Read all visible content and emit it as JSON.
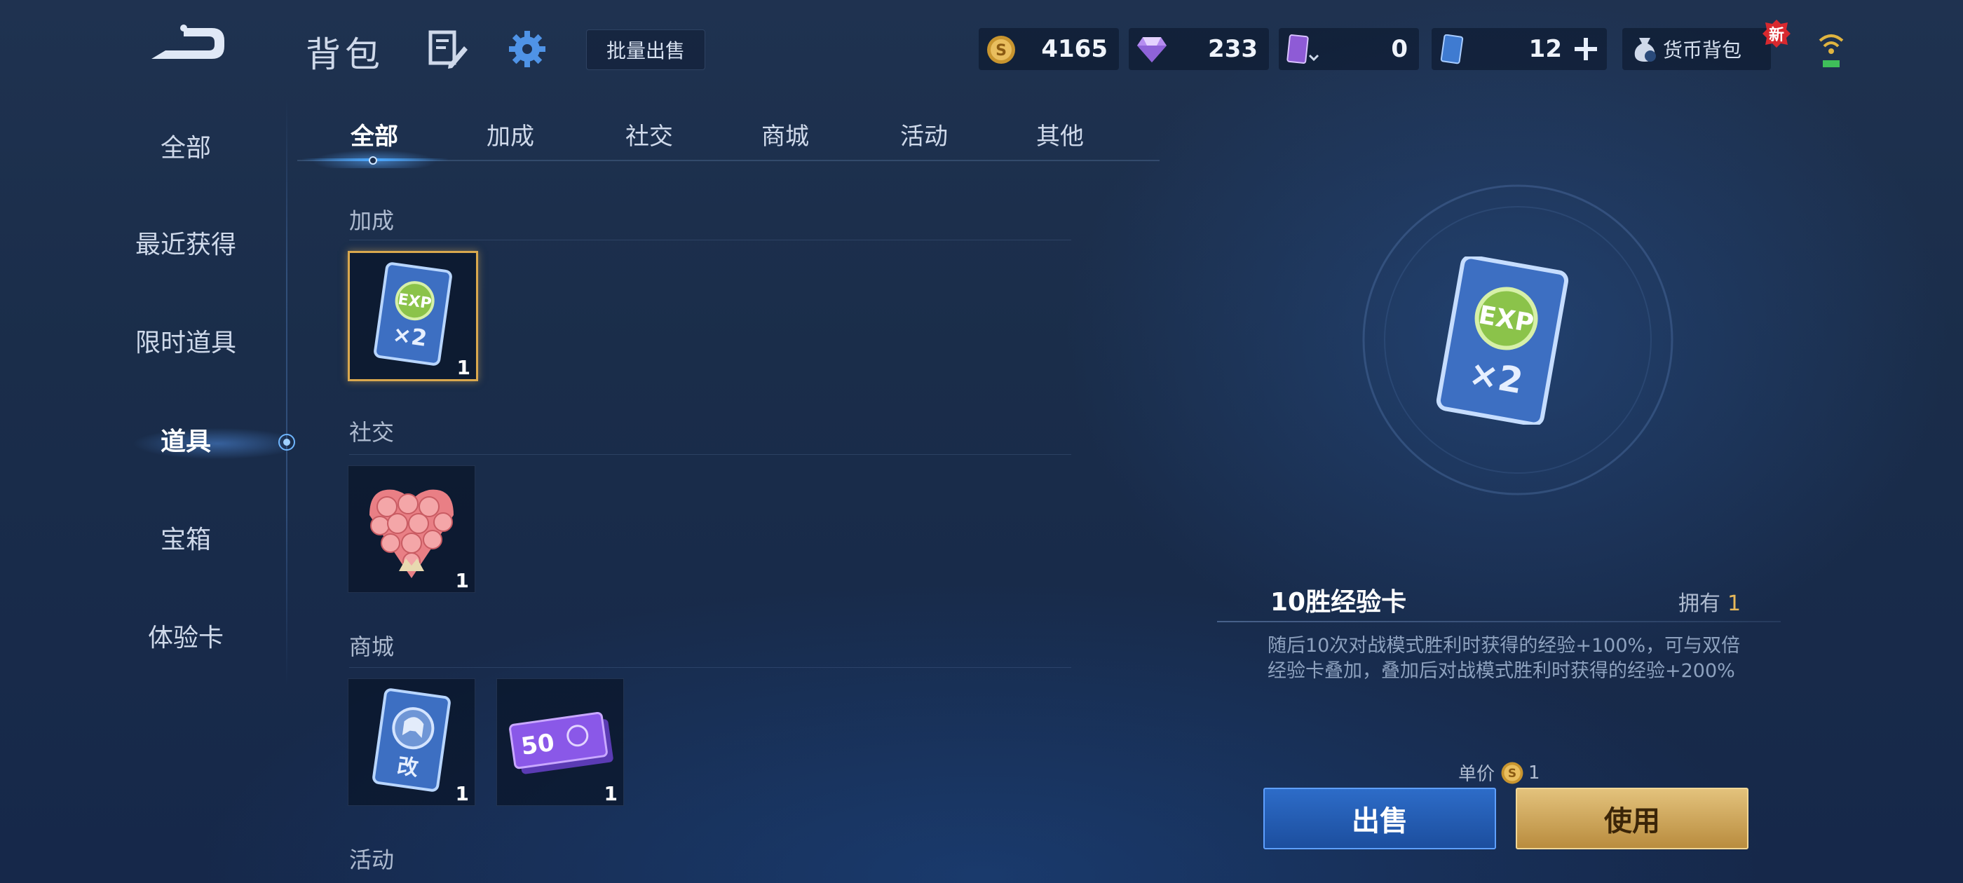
{
  "header": {
    "title": "背包",
    "batch_sell_label": "批量出售",
    "currencies": [
      {
        "icon": "gold-coin-icon",
        "value": "4165"
      },
      {
        "icon": "diamond-icon",
        "value": "233"
      },
      {
        "icon": "purple-card-icon",
        "value": "0"
      },
      {
        "icon": "blue-card-icon",
        "value": "12"
      }
    ],
    "wallet_label": "货币背包",
    "new_badge": "新"
  },
  "sidebar": {
    "items": [
      {
        "label": "全部"
      },
      {
        "label": "最近获得"
      },
      {
        "label": "限时道具"
      },
      {
        "label": "道具",
        "active": true
      },
      {
        "label": "宝箱"
      },
      {
        "label": "体验卡"
      }
    ]
  },
  "tabs": [
    {
      "label": "全部",
      "active": true
    },
    {
      "label": "加成"
    },
    {
      "label": "社交"
    },
    {
      "label": "商城"
    },
    {
      "label": "活动"
    },
    {
      "label": "其他"
    }
  ],
  "sections": [
    {
      "label": "加成",
      "items": [
        {
          "name": "exp-card-x2",
          "count": "1",
          "selected": true
        }
      ]
    },
    {
      "label": "社交",
      "items": [
        {
          "name": "rose-bouquet",
          "count": "1"
        }
      ]
    },
    {
      "label": "商城",
      "items": [
        {
          "name": "rename-card",
          "count": "1"
        },
        {
          "name": "ticket-50",
          "count": "1"
        }
      ]
    },
    {
      "label": "活动",
      "items": []
    }
  ],
  "item_art": {
    "exp_text": "EXP",
    "multiplier_text": "×2",
    "rename_text": "改",
    "ticket_text": "50"
  },
  "detail": {
    "name": "10胜经验卡",
    "own_label": "拥有",
    "own_count": "1",
    "description": "随后10次对战模式胜利时获得的经验+100%，可与双倍经验卡叠加，叠加后对战模式胜利时获得的经验+200%",
    "price_label": "单价",
    "price_value": "1",
    "sell_label": "出售",
    "use_label": "使用"
  },
  "colors": {
    "accent_gold": "#d9a84e",
    "accent_blue": "#4aa8ff",
    "sell_button": "#2d6cc8",
    "use_button": "#e3c27c"
  }
}
